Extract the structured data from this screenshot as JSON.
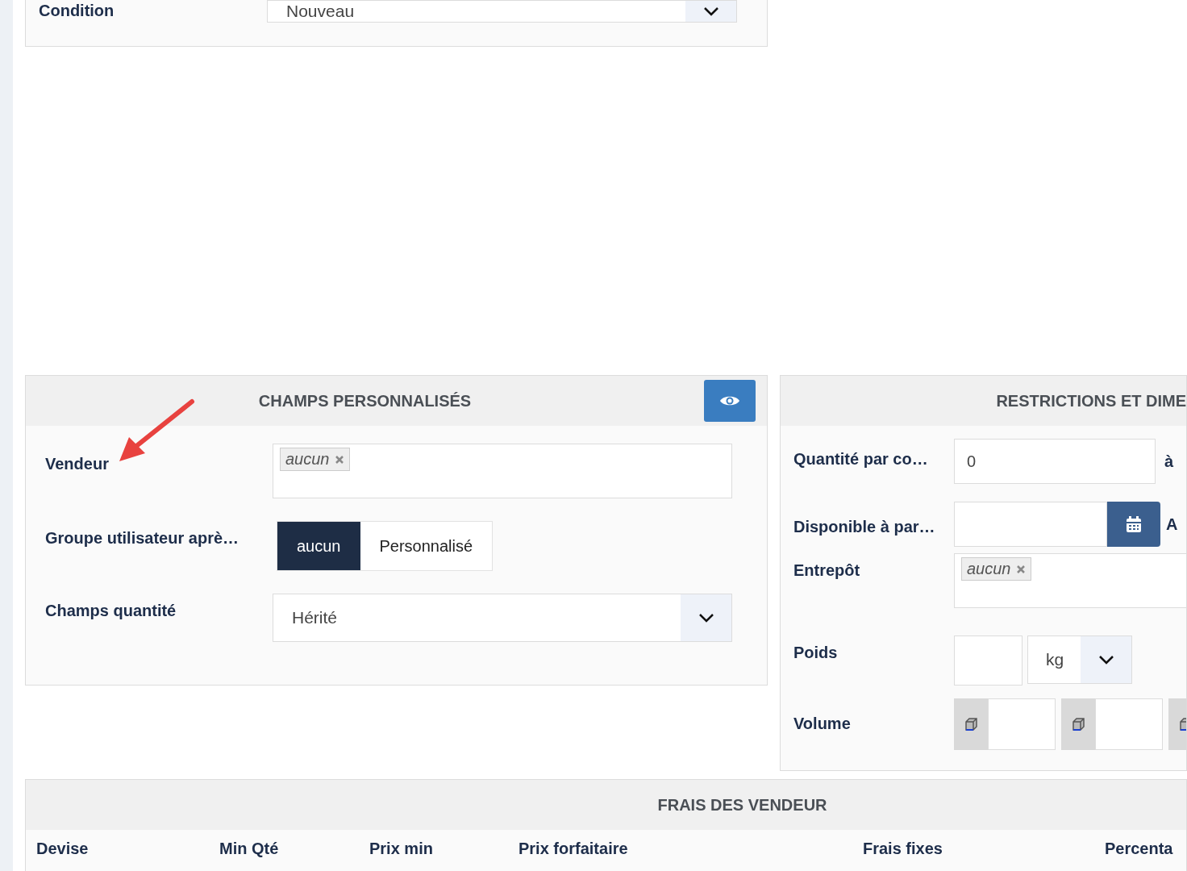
{
  "top_panel": {
    "fields": [
      {
        "label": "Condition",
        "kind": "select",
        "value": "Nouveau"
      }
    ]
  },
  "custom_fields": {
    "title": "CHAMPS PERSONNALISÉS",
    "fields": [
      {
        "label": "Vendeur",
        "kind": "tags",
        "tags": [
          "aucun"
        ]
      },
      {
        "label": "Groupe utilisateur aprè…",
        "kind": "toggle",
        "options": [
          {
            "label": "aucun",
            "selected": true
          },
          {
            "label": "Personnalisé",
            "selected": false
          }
        ]
      },
      {
        "label": "Champs quantité",
        "kind": "select",
        "value": "Hérité"
      }
    ]
  },
  "restrictions": {
    "title": "RESTRICTIONS ET DIME",
    "fields": [
      {
        "label": "Quantité par co…",
        "kind": "number",
        "value": "0",
        "suffix": "à"
      },
      {
        "label": "Disponible à par…",
        "kind": "date",
        "suffix": "A"
      },
      {
        "label": "Entrepôt",
        "kind": "tags",
        "tags": [
          "aucun"
        ]
      },
      {
        "label": "Poids",
        "kind": "weight",
        "unit": "kg"
      },
      {
        "label": "Volume",
        "kind": "volume"
      }
    ]
  },
  "seller_fees": {
    "title": "FRAIS DES VENDEUR",
    "columns": [
      "Devise",
      "Min Qté",
      "Prix min",
      "Prix forfaitaire",
      "Frais fixes",
      "Percenta"
    ]
  }
}
